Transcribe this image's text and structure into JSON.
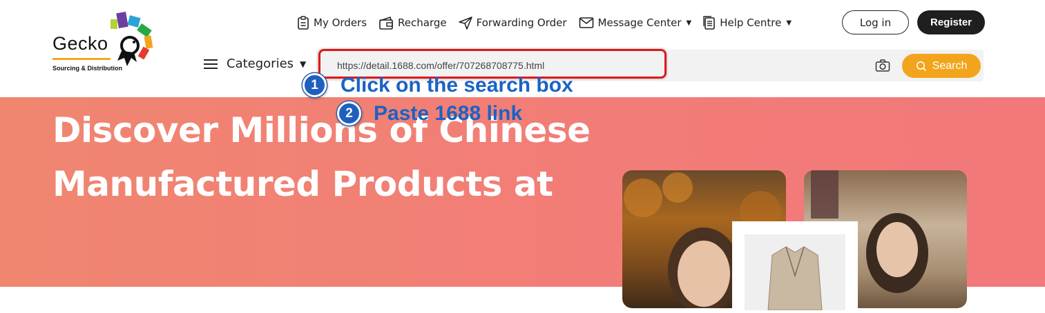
{
  "logo": {
    "name": "Gecko",
    "tagline": "Sourcing & Distribution"
  },
  "topnav": [
    {
      "label": "My Orders",
      "icon": "clipboard-icon"
    },
    {
      "label": "Recharge",
      "icon": "wallet-icon"
    },
    {
      "label": "Forwarding Order",
      "icon": "paper-plane-icon"
    },
    {
      "label": "Message Center",
      "icon": "envelope-icon",
      "dropdown": true
    },
    {
      "label": "Help Centre",
      "icon": "document-icon",
      "dropdown": true
    }
  ],
  "auth": {
    "login_label": "Log in",
    "register_label": "Register"
  },
  "search": {
    "categories_label": "Categories",
    "value": "https://detail.1688.com/offer/707268708775.html",
    "button_label": "Search"
  },
  "annotations": [
    {
      "number": "1",
      "text": "Click on the search box"
    },
    {
      "number": "2",
      "text": "Paste 1688 link"
    }
  ],
  "hero": {
    "title_line1": "Discover Millions of Chinese",
    "title_line2": "Manufactured Products at"
  },
  "colors": {
    "accent": "#f2a51c",
    "hero_bg": "#f27c78",
    "annotation_blue": "#1a63c4",
    "highlight_red": "#e01818"
  }
}
